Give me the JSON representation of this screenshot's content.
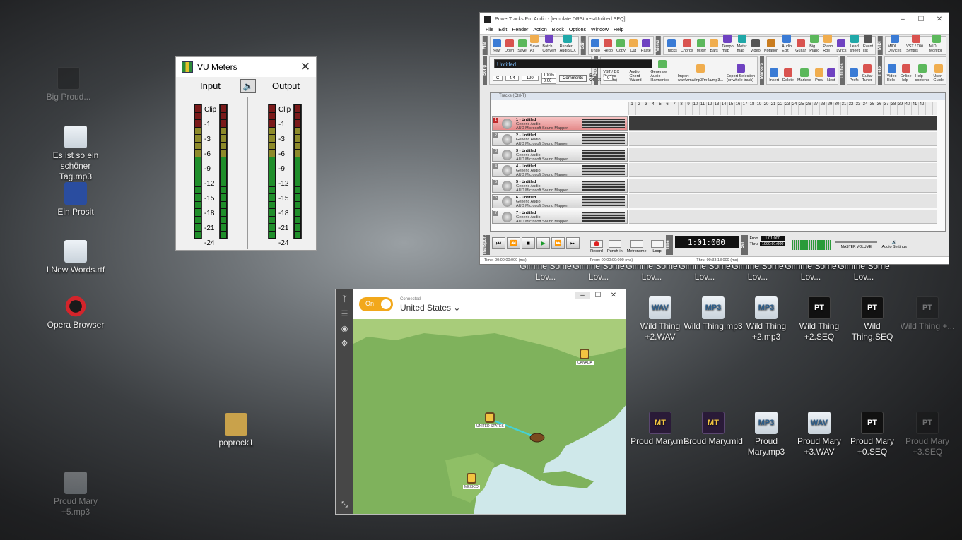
{
  "desktop": {
    "icons": [
      {
        "label": "Gimme Some Lov...",
        "kind": "pt",
        "dim": false
      },
      {
        "label": "Gimme Some Lov...",
        "kind": "pt",
        "dim": false
      },
      {
        "label": "Gimme Some Lov...",
        "kind": "pt",
        "dim": false
      },
      {
        "label": "Gimme Some Lov...",
        "kind": "pt",
        "dim": false
      },
      {
        "label": "Gimme Some Lov...",
        "kind": "pt",
        "dim": false
      },
      {
        "label": "Gimme Some Lov...",
        "kind": "pt",
        "dim": false
      },
      {
        "label": "Gimme Some Lov...",
        "kind": "pt",
        "dim": false
      },
      {
        "label": "Wild Thing +2.WAV",
        "kind": "wav",
        "badge": "WAV"
      },
      {
        "label": "Wild Thing.mp3",
        "kind": "mp3",
        "badge": "MP3"
      },
      {
        "label": "Wild Thing +2.mp3",
        "kind": "mp3",
        "badge": "MP3"
      },
      {
        "label": "Wild Thing +2.SEQ",
        "kind": "pt",
        "badge": "PT"
      },
      {
        "label": "Wild Thing.SEQ",
        "kind": "pt",
        "badge": "PT"
      },
      {
        "label": "Wild Thing +...",
        "kind": "pt",
        "badge": "PT",
        "dim": true
      },
      {
        "label": "Proud Mary.mts",
        "kind": "mt",
        "badge": "MT"
      },
      {
        "label": "Proud Mary.mid",
        "kind": "mt",
        "badge": "MT"
      },
      {
        "label": "Proud Mary.mp3",
        "kind": "mp3",
        "badge": "MP3"
      },
      {
        "label": "Proud Mary +3.WAV",
        "kind": "wav",
        "badge": "WAV"
      },
      {
        "label": "Proud Mary +0.SEQ",
        "kind": "pt",
        "badge": "PT"
      },
      {
        "label": "Proud Mary +3.SEQ",
        "kind": "pt",
        "badge": "PT",
        "dim": true
      },
      {
        "label": "poprock1",
        "kind": "folder",
        "badge": ""
      },
      {
        "label": "Big Proud...",
        "kind": "pt",
        "badge": "",
        "dim": true
      },
      {
        "label": "Es ist so ein schöner Tag.mp3",
        "kind": "mp3",
        "badge": ""
      },
      {
        "label": "Ein Prosit",
        "kind": "blue",
        "badge": ""
      },
      {
        "label": "I New Words.rtf",
        "kind": "mp3",
        "badge": ""
      },
      {
        "label": "Opera Browser",
        "kind": "opera",
        "badge": ""
      },
      {
        "label": "Proud Mary +5.mp3",
        "kind": "mp3",
        "badge": "",
        "dim": true
      }
    ]
  },
  "vu": {
    "title": "VU Meters",
    "input_label": "Input",
    "output_label": "Output",
    "scale": [
      "Clip",
      "-1",
      "-3",
      "-6",
      "-9",
      "-12",
      "-15",
      "-18",
      "-21",
      "-24"
    ]
  },
  "pt": {
    "title": "PowerTracks Pro Audio - [template:DRStores\\Untitled.SEQ]",
    "menu": [
      "File",
      "Edit",
      "Render",
      "Action",
      "Block",
      "Options",
      "Window",
      "Help"
    ],
    "toolbar_file": [
      "New",
      "Open",
      "Save",
      "Save As",
      "Batch Convert",
      "Render Audio/DX"
    ],
    "toolbar_edit": [
      "Undo",
      "Redo",
      "Copy",
      "Cut",
      "Paste"
    ],
    "toolbar_views": [
      "Tracks",
      "Chords",
      "Mixer",
      "Bars",
      "Tempo map",
      "Meter map",
      "Video",
      "Notation",
      "Audio Edit",
      "Guitar",
      "Big Piano",
      "Piano Roll",
      "Lyrics",
      "Lead sheet",
      "Event list"
    ],
    "toolbar_midi": [
      "MIDI Devices",
      "VST / DXi Synths",
      "MIDI Monitor"
    ],
    "song_title": "Untitled",
    "key": "C",
    "meter": "4/4",
    "tempo": "120",
    "tap_pct": "100%",
    "tap_value": "0.00",
    "comments": "Comments",
    "bar_offset_label": "Bar Offset",
    "bar_offset": "0",
    "audio_tools": [
      "VST / DX Plugins (effects)",
      "Audio Chord Wizard",
      "Generate Audio Harmonies",
      "Import wav/wma/mp3/m4a/mp3...",
      "Export Selection (or whole track)"
    ],
    "markers": [
      "Insert",
      "Delete",
      "Markers",
      "Prev",
      "Next"
    ],
    "utilities": [
      "Prefs",
      "Guitar Tuner"
    ],
    "help": [
      "Video Help",
      "Online Help",
      "Help contents",
      "User Guide"
    ],
    "tracks_pane_title": "Tracks (Ctrl-T)",
    "ruler": [
      "1",
      "2",
      "3",
      "4",
      "5",
      "6",
      "7",
      "8",
      "9",
      "10",
      "11",
      "12",
      "13",
      "14",
      "15",
      "16",
      "17",
      "18",
      "19",
      "20",
      "21",
      "22",
      "23",
      "24",
      "25",
      "26",
      "27",
      "28",
      "29",
      "30",
      "31",
      "32",
      "33",
      "34",
      "35",
      "36",
      "37",
      "38",
      "39",
      "40",
      "41",
      "42"
    ],
    "tracks": [
      {
        "num": "1",
        "name": "1 - Untitled",
        "sub1": "Generic Audio",
        "sub2": "AUD Microsoft Sound Mapper",
        "selected": true
      },
      {
        "num": "2",
        "name": "2 - Untitled",
        "sub1": "Generic Audio",
        "sub2": "AUD Microsoft Sound Mapper",
        "selected": false
      },
      {
        "num": "3",
        "name": "3 - Untitled",
        "sub1": "Generic Audio",
        "sub2": "AUD Microsoft Sound Mapper",
        "selected": false
      },
      {
        "num": "4",
        "name": "4 - Untitled",
        "sub1": "Generic Audio",
        "sub2": "AUD Microsoft Sound Mapper",
        "selected": false
      },
      {
        "num": "5",
        "name": "5 - Untitled",
        "sub1": "Generic Audio",
        "sub2": "AUD Microsoft Sound Mapper",
        "selected": false
      },
      {
        "num": "6",
        "name": "6 - Untitled",
        "sub1": "Generic Audio",
        "sub2": "AUD Microsoft Sound Mapper",
        "selected": false
      },
      {
        "num": "7",
        "name": "7 - Untitled",
        "sub1": "Generic Audio",
        "sub2": "AUD Microsoft Sound Mapper",
        "selected": false
      }
    ],
    "transport_labels": [
      "Record",
      "Punch-in",
      "Metronome",
      "Loop"
    ],
    "time_display": "1:01:000",
    "from": "1:01:000",
    "thru": "1000:01:000",
    "from_label": "From",
    "thru_label": "Thru",
    "master_volume": "MASTER VOLUME",
    "audio_settings": "Audio Settings",
    "status": [
      "Time: 00:00:00:000 (ms)",
      "From: 00:00:00:000 (ms)",
      "Thru: 00:33:18:000 (ms)"
    ]
  },
  "vpn": {
    "toggle_label": "On",
    "status": "Connected",
    "country": "United States",
    "pins": [
      "CANADA",
      "UNITED STATES",
      "MEXICO"
    ]
  }
}
